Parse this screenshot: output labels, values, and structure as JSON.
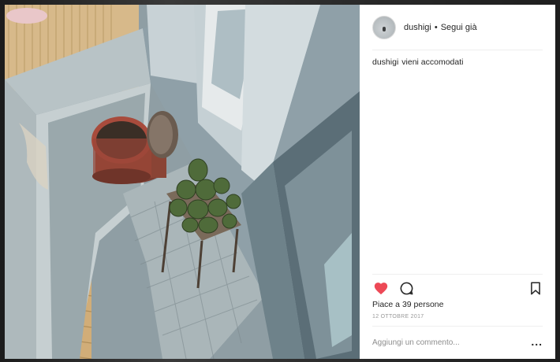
{
  "post": {
    "username": "dushigi",
    "separator": "•",
    "follow_label": "Segui già",
    "caption_user": "dushigi",
    "caption_text": "vieni accomodati",
    "likes_text": "Piace a 39 persone",
    "date": "12 OTTOBRE 2017",
    "comment_placeholder": "Aggiungi un commento...",
    "more_label": "...",
    "heart_color": "#ed4956"
  },
  "icons": {
    "like": "heart-icon",
    "comment": "comment-icon",
    "save": "bookmark-icon",
    "options": "more-options-icon"
  }
}
